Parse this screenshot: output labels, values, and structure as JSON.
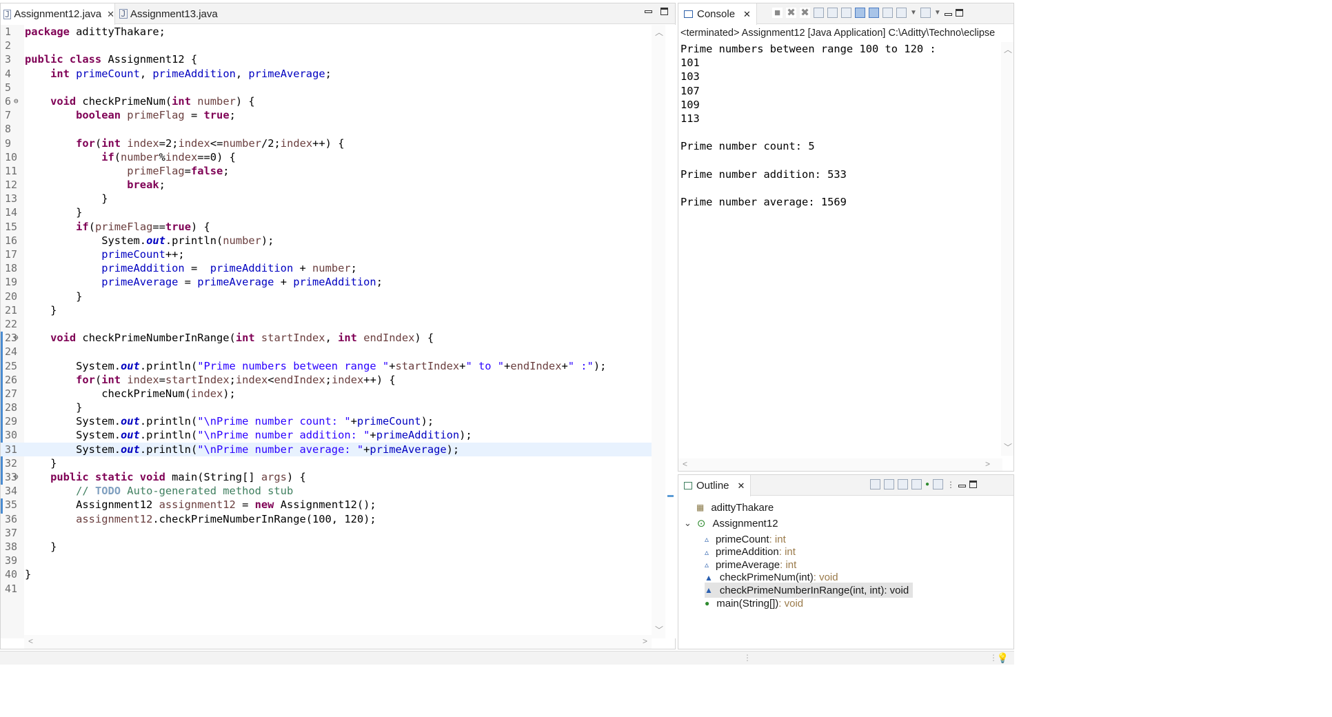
{
  "editor": {
    "tabs": [
      {
        "label": "Assignment12.java",
        "active": true
      },
      {
        "label": "Assignment13.java",
        "active": false
      }
    ],
    "highlighted_line": 31,
    "lines": [
      {
        "n": "1",
        "html": "<span class=\"kw\">package</span> adittyThakare;"
      },
      {
        "n": "2",
        "html": ""
      },
      {
        "n": "3",
        "html": "<span class=\"kw\">public class</span> Assignment12 {"
      },
      {
        "n": "4",
        "html": "    <span class=\"kw\">int</span> <span class=\"fld\">primeCount</span>, <span class=\"fld\">primeAddition</span>, <span class=\"fld\">primeAverage</span>;"
      },
      {
        "n": "5",
        "html": ""
      },
      {
        "n": "6",
        "fold": true,
        "html": "    <span class=\"kw\">void</span> checkPrimeNum(<span class=\"kw\">int</span> <span class=\"vr\">number</span>) {"
      },
      {
        "n": "7",
        "html": "        <span class=\"kw\">boolean</span> <span class=\"vr\">primeFlag</span> = <span class=\"kw\">true</span>;"
      },
      {
        "n": "8",
        "html": ""
      },
      {
        "n": "9",
        "html": "        <span class=\"kw\">for</span>(<span class=\"kw\">int</span> <span class=\"vr\">index</span>=2;<span class=\"vr\">index</span>&lt;=<span class=\"vr\">number</span>/2;<span class=\"vr\">index</span>++) {"
      },
      {
        "n": "10",
        "html": "            <span class=\"kw\">if</span>(<span class=\"vr\">number</span>%<span class=\"vr\">index</span>==0) {"
      },
      {
        "n": "11",
        "html": "                <span class=\"vr\">primeFlag</span>=<span class=\"kw\">false</span>;"
      },
      {
        "n": "12",
        "html": "                <span class=\"kw\">break</span>;"
      },
      {
        "n": "13",
        "html": "            }"
      },
      {
        "n": "14",
        "html": "        }"
      },
      {
        "n": "15",
        "html": "        <span class=\"kw\">if</span>(<span class=\"vr\">primeFlag</span>==<span class=\"kw\">true</span>) {"
      },
      {
        "n": "16",
        "html": "            System.<span class=\"st\">out</span>.println(<span class=\"vr\">number</span>);"
      },
      {
        "n": "17",
        "html": "            <span class=\"fld\">primeCount</span>++;"
      },
      {
        "n": "18",
        "html": "            <span class=\"fld\">primeAddition</span> =  <span class=\"fld\">primeAddition</span> + <span class=\"vr\">number</span>;"
      },
      {
        "n": "19",
        "html": "            <span class=\"fld\">primeAverage</span> = <span class=\"fld\">primeAverage</span> + <span class=\"fld\">primeAddition</span>;"
      },
      {
        "n": "20",
        "html": "        }"
      },
      {
        "n": "21",
        "html": "    }"
      },
      {
        "n": "22",
        "html": ""
      },
      {
        "n": "23",
        "fold": true,
        "html": "    <span class=\"kw\">void</span> checkPrimeNumberInRange(<span class=\"kw\">int</span> <span class=\"vr\">startIndex</span>, <span class=\"kw\">int</span> <span class=\"vr\">endIndex</span>) {"
      },
      {
        "n": "24",
        "html": ""
      },
      {
        "n": "25",
        "html": "        System.<span class=\"st\">out</span>.println(<span class=\"str\">\"Prime numbers between range \"</span>+<span class=\"vr\">startIndex</span>+<span class=\"str\">\" to \"</span>+<span class=\"vr\">endIndex</span>+<span class=\"str\">\" :\"</span>);"
      },
      {
        "n": "26",
        "html": "        <span class=\"kw\">for</span>(<span class=\"kw\">int</span> <span class=\"vr\">index</span>=<span class=\"vr\">startIndex</span>;<span class=\"vr\">index</span>&lt;<span class=\"vr\">endIndex</span>;<span class=\"vr\">index</span>++) {"
      },
      {
        "n": "27",
        "html": "            checkPrimeNum(<span class=\"vr\">index</span>);"
      },
      {
        "n": "28",
        "html": "        }"
      },
      {
        "n": "29",
        "html": "        System.<span class=\"st\">out</span>.println(<span class=\"str\">\"\\nPrime number count: \"</span>+<span class=\"fld\">primeCount</span>);"
      },
      {
        "n": "30",
        "html": "        System.<span class=\"st\">out</span>.println(<span class=\"str\">\"\\nPrime number addition: \"</span>+<span class=\"fld\">primeAddition</span>);"
      },
      {
        "n": "31",
        "html": "        System.<span class=\"st\">out</span>.println(<span class=\"str\">\"\\nPrime number average: \"</span>+<span class=\"fld\">primeAverage</span>);"
      },
      {
        "n": "32",
        "html": "    }"
      },
      {
        "n": "33",
        "fold": true,
        "html": "    <span class=\"kw\">public static void</span> main(String[] <span class=\"vr\">args</span>) {"
      },
      {
        "n": "34",
        "html": "        <span class=\"cm\">// <span class=\"td\">TODO</span> Auto-generated method stub</span>"
      },
      {
        "n": "35",
        "html": "        Assignment12 <span class=\"vr\">assignment12</span> = <span class=\"kw\">new</span> Assignment12();"
      },
      {
        "n": "36",
        "html": "        <span class=\"vr\">assignment12</span>.checkPrimeNumberInRange(100, 120);"
      },
      {
        "n": "37",
        "html": ""
      },
      {
        "n": "38",
        "html": "    }"
      },
      {
        "n": "39",
        "html": ""
      },
      {
        "n": "40",
        "html": "}"
      },
      {
        "n": "41",
        "html": ""
      }
    ]
  },
  "console": {
    "tab_label": "Console",
    "status_line": "<terminated> Assignment12 [Java Application] C:\\Aditty\\Techno\\eclipse",
    "output": [
      "Prime numbers between range 100 to 120 :",
      "101",
      "103",
      "107",
      "109",
      "113",
      "",
      "Prime number count: 5",
      "",
      "Prime number addition: 533",
      "",
      "Prime number average: 1569"
    ]
  },
  "outline": {
    "tab_label": "Outline",
    "package": "adittyThakare",
    "class_name": "Assignment12",
    "members": [
      {
        "name": "primeCount",
        "type": " : int",
        "kind": "field"
      },
      {
        "name": "primeAddition",
        "type": " : int",
        "kind": "field"
      },
      {
        "name": "primeAverage",
        "type": " : int",
        "kind": "field"
      },
      {
        "name": "checkPrimeNum(int)",
        "type": " : void",
        "kind": "method"
      },
      {
        "name": "checkPrimeNumberInRange(int, int)",
        "type": " : void",
        "kind": "method",
        "selected": true
      },
      {
        "name": "main(String[])",
        "type": " : void",
        "kind": "static-method"
      }
    ]
  },
  "colors": {
    "keyword": "#7f0055",
    "field": "#0000c0",
    "string": "#2a00ff",
    "comment": "#3f7f5f",
    "highlight_line": "#e8f2fe"
  }
}
